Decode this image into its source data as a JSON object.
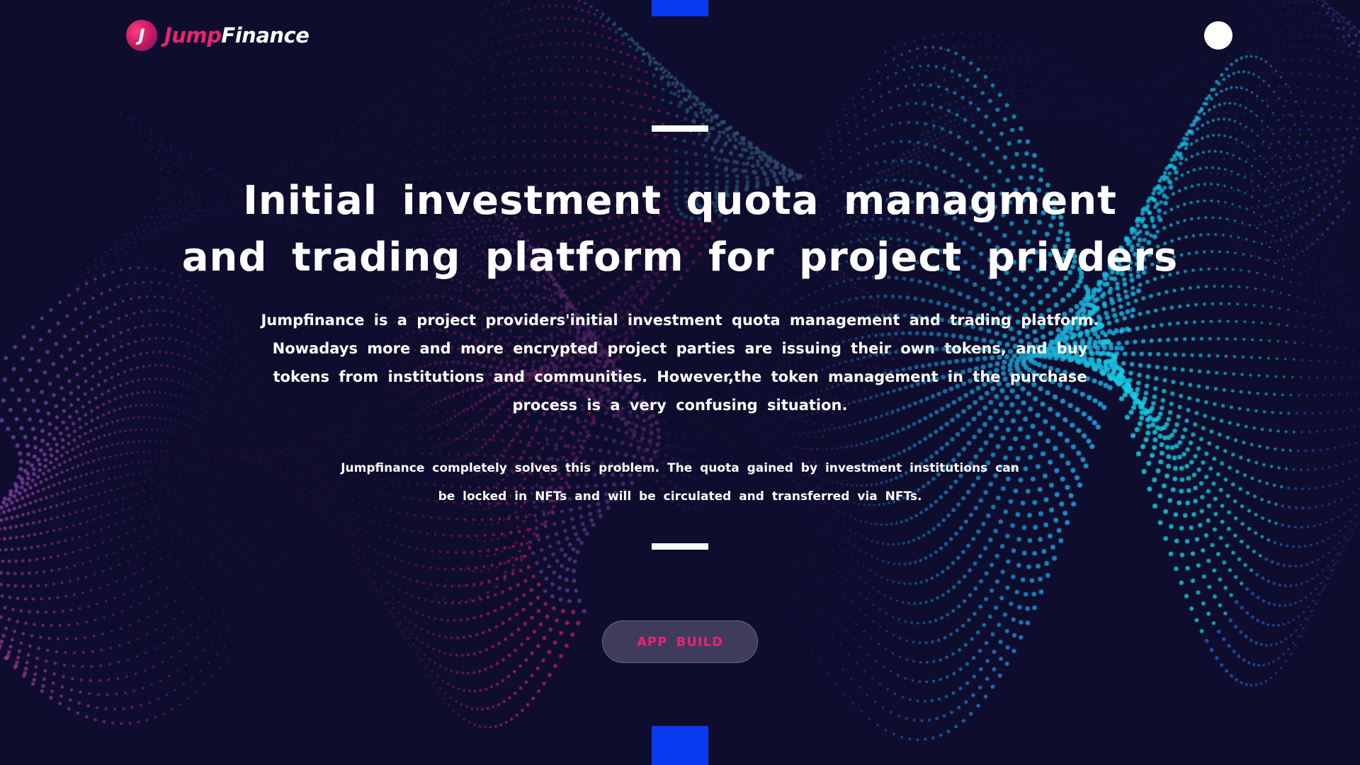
{
  "brand": {
    "name_part1": "Jump",
    "name_part2": "Finance",
    "badge_letter": "J",
    "accent_pink": "#e8246f",
    "accent_blue": "#0b3bf0",
    "background": "#0f0d2e"
  },
  "header": {
    "menu_icon": "white-circle-menu-icon"
  },
  "hero": {
    "title_line1": "Initial investment quota managment",
    "title_line2": "and trading platform for project privders",
    "lead": "Jumpfinance is a project providers'initial investment quota management and trading platform. Nowadays more and more encrypted project parties are issuing their own tokens, and buy tokens from institutions and communities. However,the token management in the purchase process is a very confusing situation.",
    "sub_line1": "Jumpfinance completely solves this problem. The quota gained by investment institutions can",
    "sub_line2": "be locked in NFTs and will be circulated and transferred via NFTs.",
    "cta_label": "APP BUILD"
  }
}
